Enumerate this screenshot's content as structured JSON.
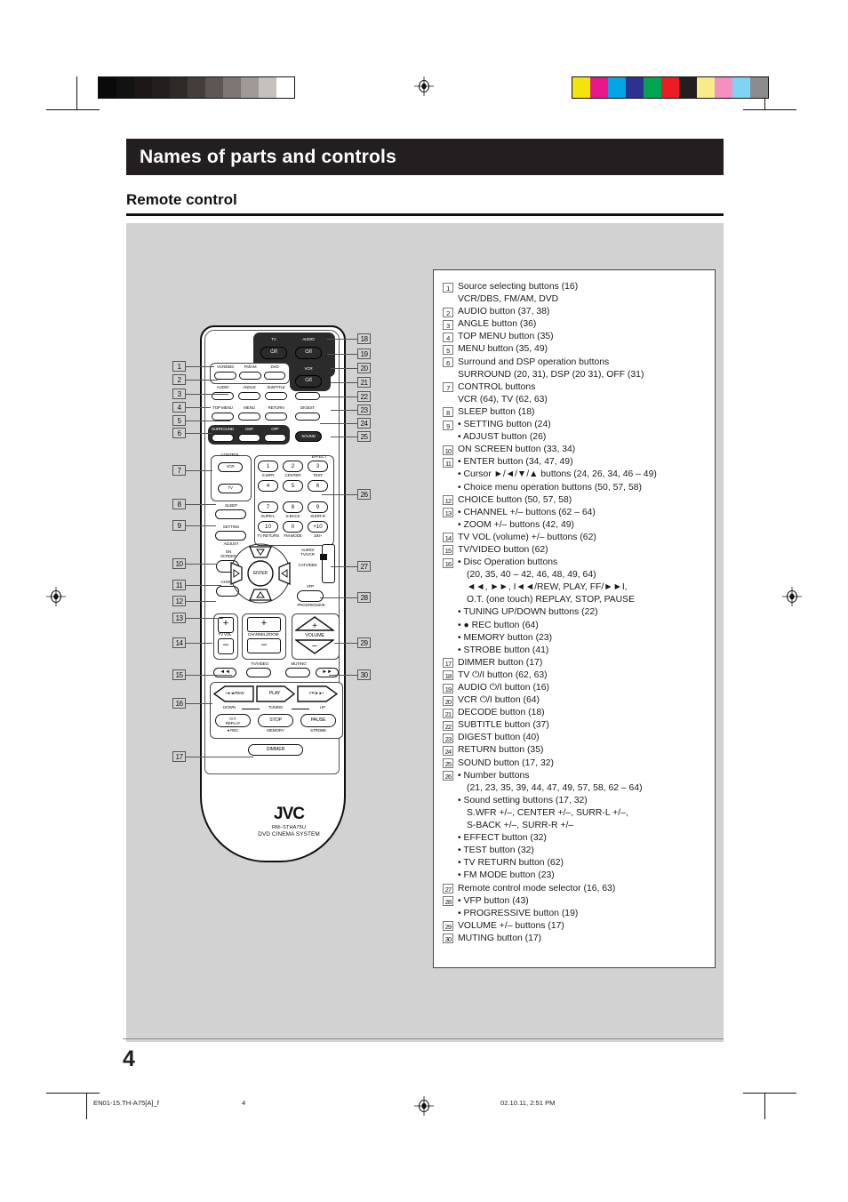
{
  "header": {
    "section_title": "Names of parts and controls",
    "subsection_title": "Remote control"
  },
  "page_number": "4",
  "footer": {
    "file_name": "EN01-15.TH-A75[A]_f",
    "page": "4",
    "timestamp": "02.10.11, 2:51 PM"
  },
  "color_bars": {
    "gray_scale": [
      "#0a0a0a",
      "#121212",
      "#1b1817",
      "#231f1e",
      "#2e2a28",
      "#443e3b",
      "#5d5653",
      "#7d7672",
      "#a09a96",
      "#c6c1bd",
      "#ffffff"
    ],
    "colors": [
      "#f5e40b",
      "#e8188c",
      "#00a5e3",
      "#2e3192",
      "#00a551",
      "#ed1c24",
      "#231f20",
      "#faeb8a",
      "#f58fc2",
      "#7fd4f5",
      "#8c8c8c"
    ]
  },
  "remote": {
    "brand": "JVC",
    "model": "RM–STHA75U",
    "system_name": "DVD CINEMA SYSTEM",
    "power_buttons": [
      {
        "label": "TV",
        "glyph": "⏻/I"
      },
      {
        "label": "AUDIO",
        "glyph": "⏻/I"
      },
      {
        "label": "VCR",
        "glyph": "⏻/I"
      }
    ],
    "source_row": [
      "VCR/DBS",
      "FM/AM",
      "DVD"
    ],
    "row2": [
      "AUDIO",
      "ANGLE",
      "SUBTITLE",
      "DECODE"
    ],
    "row3": [
      "TOP MENU",
      "MENU",
      "RETURN",
      "DIGEST"
    ],
    "row4": [
      "SURROUND",
      "DSP",
      "OFF"
    ],
    "sound_button": "SOUND",
    "control_group": {
      "title": "CONTROL",
      "buttons": [
        "VCR",
        "TV"
      ]
    },
    "left_small_buttons": [
      {
        "above": "SLEEP",
        "below": ""
      },
      {
        "above": "SETTING",
        "below": "ADJUST"
      }
    ],
    "keypad": {
      "group_label": "EFFECT",
      "keys": [
        "1",
        "2",
        "3",
        "4",
        "5",
        "6",
        "7",
        "8",
        "9",
        "10",
        "0",
        "+10"
      ],
      "sub_labels_row1": [
        "S.WFR",
        "CENTER",
        "TEST"
      ],
      "sub_labels_row3": [
        "SURR-L",
        "S-BACK",
        "SURR-R"
      ],
      "sub_labels_row4": [
        "TV RETURN",
        "FM MODE",
        "100+"
      ]
    },
    "on_screen": "ON SCREEN",
    "enter": "ENTER",
    "choice": "CHOICE",
    "mode_selector": {
      "top": "AUDIO/ TV/VCR",
      "bottom": "CATV/DBS"
    },
    "vfp": "VFP",
    "progressive": "PROGRESSIVE",
    "tv_vol": "TV VOL",
    "channel_zoom": "CHANNEL/ZOOM",
    "volume": "VOLUME",
    "tv_video": "TV/VIDEO",
    "muting": "MUTING",
    "transport": {
      "rew_fast": "◄◄",
      "ff_fast": "►►",
      "rew": "I◄◄/REW",
      "play": "PLAY",
      "ff": "FF/►►I",
      "tuning_down": "DOWN",
      "tuning": "TUNING",
      "tuning_up": "UP",
      "replay": "O.T. REPLAY",
      "stop": "STOP",
      "pause": "PAUSE",
      "rec": "● REC",
      "memory": "MEMORY",
      "strobe": "STROBE"
    },
    "dimmer": "DIMMER"
  },
  "callouts_left": [
    "1",
    "2",
    "3",
    "4",
    "5",
    "6",
    "7",
    "8",
    "9",
    "10",
    "11",
    "12",
    "13",
    "14",
    "15",
    "16",
    "17"
  ],
  "callouts_right": [
    "18",
    "19",
    "20",
    "21",
    "22",
    "23",
    "24",
    "25",
    "26",
    "27",
    "28",
    "29",
    "30"
  ],
  "legend": [
    {
      "num": "1",
      "text": "Source selecting buttons (16)",
      "subs": [
        {
          "text": "VCR/DBS, FM/AM, DVD",
          "indent": 1,
          "bullet": false
        }
      ]
    },
    {
      "num": "2",
      "text": "AUDIO button (37, 38)",
      "subs": []
    },
    {
      "num": "3",
      "text": "ANGLE button (36)",
      "subs": []
    },
    {
      "num": "4",
      "text": "TOP MENU button (35)",
      "subs": []
    },
    {
      "num": "5",
      "text": "MENU button (35, 49)",
      "subs": []
    },
    {
      "num": "6",
      "text": "Surround and DSP operation buttons",
      "subs": [
        {
          "text": "SURROUND (20, 31), DSP (20 31), OFF (31)",
          "indent": 1,
          "bullet": false
        }
      ]
    },
    {
      "num": "7",
      "text": "CONTROL buttons",
      "subs": [
        {
          "text": "VCR (64), TV (62, 63)",
          "indent": 1,
          "bullet": false
        }
      ]
    },
    {
      "num": "8",
      "text": "SLEEP button (18)",
      "subs": []
    },
    {
      "num": "9",
      "text": "SETTING button (24)",
      "bulleted": true,
      "subs": [
        {
          "text": "ADJUST button (26)",
          "indent": 1,
          "bullet": true
        }
      ]
    },
    {
      "num": "10",
      "text": "ON SCREEN button (33, 34)",
      "subs": []
    },
    {
      "num": "11",
      "text": "ENTER button (34, 47, 49)",
      "bulleted": true,
      "subs": [
        {
          "text": "Cursor ►/◄/▼/▲ buttons (24, 26, 34, 46 – 49)",
          "indent": 1,
          "bullet": true
        },
        {
          "text": "Choice menu operation buttons (50, 57, 58)",
          "indent": 1,
          "bullet": true
        }
      ]
    },
    {
      "num": "12",
      "text": "CHOICE button (50, 57, 58)",
      "subs": []
    },
    {
      "num": "13",
      "text": "CHANNEL +/– buttons (62 – 64)",
      "bulleted": true,
      "subs": [
        {
          "text": "ZOOM +/– buttons (42, 49)",
          "indent": 1,
          "bullet": true
        }
      ]
    },
    {
      "num": "14",
      "text": "TV VOL (volume) +/– buttons (62)",
      "subs": []
    },
    {
      "num": "15",
      "text": "TV/VIDEO button (62)",
      "subs": []
    },
    {
      "num": "16",
      "text": "Disc Operation buttons",
      "bulleted": true,
      "subs": [
        {
          "text": "(20, 35, 40 – 42, 46, 48, 49, 64)",
          "indent": 2,
          "bullet": false
        },
        {
          "text": "◄◄, ►►, I◄◄/REW, PLAY, FF/►►I,",
          "indent": 2,
          "bullet": false
        },
        {
          "text": "O.T.  (one touch) REPLAY, STOP, PAUSE",
          "indent": 2,
          "bullet": false
        },
        {
          "text": "TUNING UP/DOWN buttons (22)",
          "indent": 1,
          "bullet": true
        },
        {
          "text": "● REC button (64)",
          "indent": 1,
          "bullet": true
        },
        {
          "text": "MEMORY button (23)",
          "indent": 1,
          "bullet": true
        },
        {
          "text": "STROBE button (41)",
          "indent": 1,
          "bullet": true
        }
      ]
    },
    {
      "num": "17",
      "text": "DIMMER button (17)",
      "subs": []
    },
    {
      "num": "18",
      "text": "TV ⏻/I button (62, 63)",
      "subs": []
    },
    {
      "num": "19",
      "text": "AUDIO ⏻/I button (16)",
      "subs": []
    },
    {
      "num": "20",
      "text": "VCR ⏻/I button (64)",
      "subs": []
    },
    {
      "num": "21",
      "text": "DECODE button (18)",
      "subs": []
    },
    {
      "num": "22",
      "text": "SUBTITLE button (37)",
      "subs": []
    },
    {
      "num": "23",
      "text": "DIGEST button (40)",
      "subs": []
    },
    {
      "num": "24",
      "text": "RETURN button (35)",
      "subs": []
    },
    {
      "num": "25",
      "text": "SOUND button (17, 32)",
      "subs": []
    },
    {
      "num": "26",
      "text": "Number buttons",
      "bulleted": true,
      "subs": [
        {
          "text": "(21, 23, 35, 39, 44, 47, 49, 57, 58, 62 – 64)",
          "indent": 2,
          "bullet": false
        },
        {
          "text": "Sound setting buttons (17, 32)",
          "indent": 1,
          "bullet": true
        },
        {
          "text": "S.WFR +/–, CENTER +/–, SURR-L +/–,",
          "indent": 2,
          "bullet": false
        },
        {
          "text": "S-BACK +/–, SURR-R +/–",
          "indent": 2,
          "bullet": false
        },
        {
          "text": "EFFECT button (32)",
          "indent": 1,
          "bullet": true
        },
        {
          "text": "TEST button (32)",
          "indent": 1,
          "bullet": true
        },
        {
          "text": "TV RETURN button (62)",
          "indent": 1,
          "bullet": true
        },
        {
          "text": "FM MODE button (23)",
          "indent": 1,
          "bullet": true
        }
      ]
    },
    {
      "num": "27",
      "text": "Remote control mode selector (16, 63)",
      "subs": []
    },
    {
      "num": "28",
      "text": "VFP button (43)",
      "bulleted": true,
      "subs": [
        {
          "text": "PROGRESSIVE button (19)",
          "indent": 1,
          "bullet": true
        }
      ]
    },
    {
      "num": "29",
      "text": "VOLUME +/– buttons (17)",
      "subs": []
    },
    {
      "num": "30",
      "text": "MUTING button (17)",
      "subs": []
    }
  ]
}
